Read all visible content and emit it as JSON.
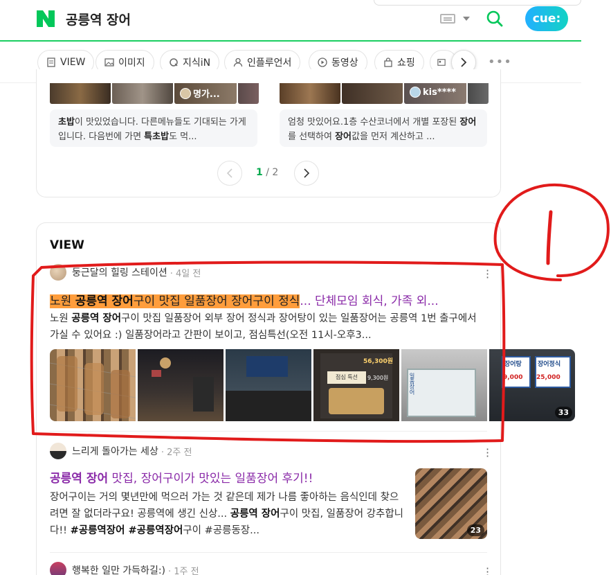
{
  "header": {
    "query": "공릉역 장어",
    "cue_label": "cue:"
  },
  "tabs": [
    {
      "label": "VIEW",
      "icon": "document-icon"
    },
    {
      "label": "이미지",
      "icon": "image-icon"
    },
    {
      "label": "지식iN",
      "icon": "q-icon"
    },
    {
      "label": "인플루언서",
      "icon": "person-icon"
    },
    {
      "label": "동영상",
      "icon": "play-icon"
    },
    {
      "label": "쇼핑",
      "icon": "bag-icon"
    }
  ],
  "reviews": {
    "left_author": "명가...",
    "right_author": "kis****",
    "left_snippet_parts": [
      "초밥",
      "이 맛있었습니다. 다른메뉴들도 기대되는 가게입니다. 다음번에 가면 ",
      "특초밥",
      "도 먹..."
    ],
    "right_snippet_parts": [
      "엄청 맛있어요.1층 수산코너에서 개별 포장된 ",
      "장어",
      "를 선택하여 ",
      "장어",
      "값을 먼저 계산하고 ..."
    ],
    "pager_current": "1",
    "pager_total": "/ 2"
  },
  "view": {
    "section_title": "VIEW",
    "posts": [
      {
        "author": "둥근달의 힐링 스테이션",
        "date": "· 4일 전",
        "title_hl_pre": "노원 ",
        "title_hl_bold": "공릉역 장어",
        "title_hl_post": "구이 맛집 일품장어 장어구이 정식",
        "title_rest": "... 단체모임 회식, 가족 외...",
        "body_pre": "노원 ",
        "body_bold": "공릉역 장어",
        "body_post": "구이 맛집 일품장어 외부 장어 정식과 장어탕이 있는 일품장어는 공릉역 1번 출구에서 가실 수 있어요 :) 일품장어라고 간판이 보이고, 점심특선(오전 11시-오후3...",
        "image_count": "33"
      },
      {
        "author": "느리게 돌아가는 세상",
        "date": "· 2주 전",
        "title_bold": "공릉역 장어",
        "title_rest": " 맛집, 장어구이가 맛있는 일품장어 후기!!",
        "body_pre": "장어구이는 거의 몇년만에 먹으러 가는 것 같은데 제가 나름 좋아하는 음식인데 찾으려면 잘 없더라구요! 공릉역에 생긴 신상... ",
        "body_bold1": "공릉역 장어",
        "body_mid": "구이 맛집, 일품장어 강추합니다!! ",
        "body_bold2": "#공릉역장어 #공릉역장어",
        "body_post": "구이 #공릉동장...",
        "image_count": "23"
      },
      {
        "author": "행복한 일만 가득하길:)",
        "date": "· 1주 전"
      }
    ]
  },
  "image_labels": {
    "sign_price_top": "56,300원",
    "menu_title": "점심 특선",
    "menu_price": "9,300원",
    "side_text": "일품장어",
    "sign1": "장어탕",
    "sign1_price": "9,000",
    "sign2": "장어정식",
    "sign2_price": "25,000"
  },
  "annotation": {
    "mark": "!",
    "color": "#e11b1b"
  }
}
